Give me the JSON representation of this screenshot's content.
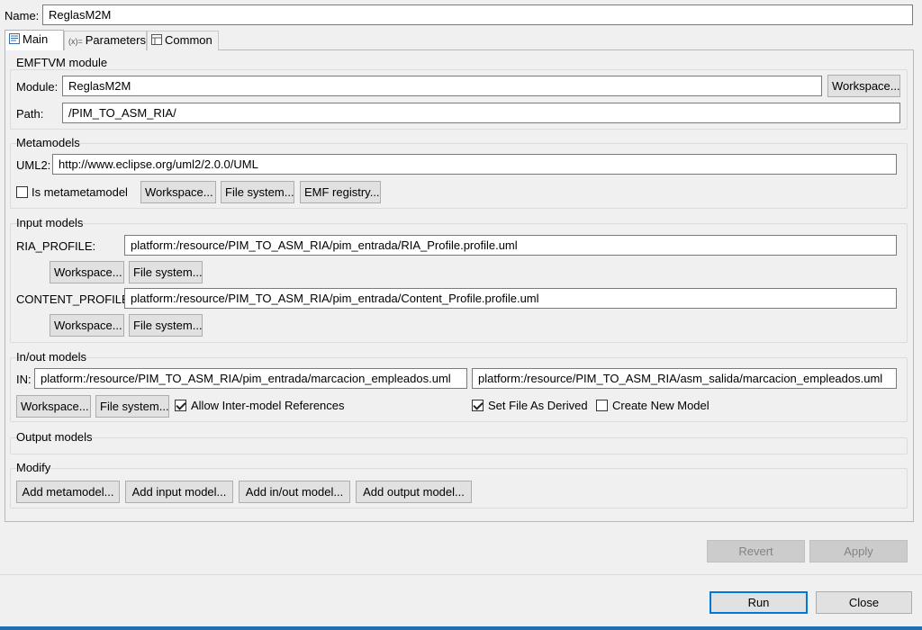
{
  "name": {
    "label": "Name:",
    "value": "ReglasM2M"
  },
  "tabs": [
    {
      "label": "Main",
      "icon": "main-tab-icon"
    },
    {
      "label": "Parameters",
      "icon": "parameters-tab-icon",
      "icon_text": "(x)="
    },
    {
      "label": "Common",
      "icon": "common-tab-icon"
    }
  ],
  "emftvm": {
    "title": "EMFTVM module",
    "module_label": "Module:",
    "module_value": "ReglasM2M",
    "workspace_btn": "Workspace...",
    "path_label": "Path:",
    "path_value": "/PIM_TO_ASM_RIA/"
  },
  "metamodels": {
    "title": "Metamodels",
    "uml2_label": "UML2:",
    "uml2_value": "http://www.eclipse.org/uml2/2.0.0/UML",
    "is_metametamodel_label": "Is metametamodel",
    "is_metametamodel_checked": false,
    "workspace_btn": "Workspace...",
    "filesystem_btn": "File system...",
    "emf_registry_btn": "EMF registry..."
  },
  "input_models": {
    "title": "Input models",
    "items": [
      {
        "label": "RIA_PROFILE:",
        "value": "platform:/resource/PIM_TO_ASM_RIA/pim_entrada/RIA_Profile.profile.uml",
        "workspace_btn": "Workspace...",
        "filesystem_btn": "File system..."
      },
      {
        "label": "CONTENT_PROFILE:",
        "value": "platform:/resource/PIM_TO_ASM_RIA/pim_entrada/Content_Profile.profile.uml",
        "workspace_btn": "Workspace...",
        "filesystem_btn": "File system..."
      }
    ]
  },
  "inout_models": {
    "title": "In/out models",
    "in_label": "IN:",
    "in_value": "platform:/resource/PIM_TO_ASM_RIA/pim_entrada/marcacion_empleados.uml",
    "out_value": "platform:/resource/PIM_TO_ASM_RIA/asm_salida/marcacion_empleados.uml",
    "workspace_btn": "Workspace...",
    "filesystem_btn": "File system...",
    "allow_inter_label": "Allow Inter-model References",
    "allow_inter_checked": true,
    "set_derived_label": "Set File As Derived",
    "set_derived_checked": true,
    "create_new_label": "Create New Model",
    "create_new_checked": false
  },
  "output_models": {
    "title": "Output models"
  },
  "modify": {
    "title": "Modify",
    "add_metamodel": "Add metamodel...",
    "add_input": "Add input model...",
    "add_inout": "Add in/out model...",
    "add_output": "Add output model..."
  },
  "footer": {
    "revert": "Revert",
    "apply": "Apply",
    "run": "Run",
    "close": "Close"
  },
  "colors": {
    "background": "#f0f0f0",
    "accent": "#0078d7",
    "disabled_button": "#cccccc"
  }
}
